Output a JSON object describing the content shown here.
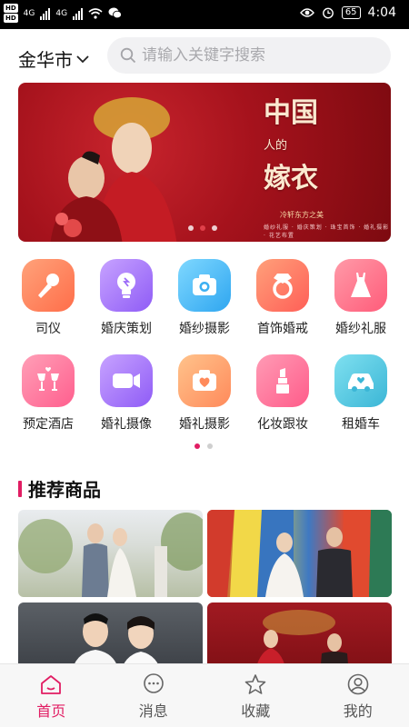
{
  "status_bar": {
    "hd1": "HD",
    "hd2": "HD",
    "net1": "4G",
    "net2": "4G",
    "battery": "65",
    "time": "4:04"
  },
  "header": {
    "city": "金华市",
    "search_placeholder": "请输入关键字搜索"
  },
  "banner": {
    "title_line1": "中国",
    "title_mid": "人的",
    "title_line2": "嫁衣",
    "tagline": "冷轩东方之美",
    "fineprint": "婚纱礼服 · 婚庆策划 · 珠宝首饰 · 婚礼摄影 · 花艺布置",
    "slide_count": 3,
    "active_slide": 2
  },
  "categories": [
    {
      "label": "司仪",
      "icon": "microphone-icon",
      "color1": "#ffa27a",
      "color2": "#ff6e4a"
    },
    {
      "label": "婚庆策划",
      "icon": "lightbulb-icon",
      "color1": "#c7a2ff",
      "color2": "#8f5cf6"
    },
    {
      "label": "婚纱摄影",
      "icon": "camera-icon",
      "color1": "#7fd8ff",
      "color2": "#2fa6f0"
    },
    {
      "label": "首饰婚戒",
      "icon": "diamond-ring-icon",
      "color1": "#ffa07a",
      "color2": "#ff5f57"
    },
    {
      "label": "婚纱礼服",
      "icon": "dress-icon",
      "color1": "#ff9aa8",
      "color2": "#ff5c7a"
    },
    {
      "label": "预定酒店",
      "icon": "wine-glasses-icon",
      "color1": "#ff9fb7",
      "color2": "#ff5f8e"
    },
    {
      "label": "婚礼摄像",
      "icon": "video-camera-icon",
      "color1": "#c7a2ff",
      "color2": "#8f5cf6"
    },
    {
      "label": "婚礼摄影",
      "icon": "heart-camera-icon",
      "color1": "#ffc38b",
      "color2": "#ff8a5b"
    },
    {
      "label": "化妆跟妆",
      "icon": "lipstick-icon",
      "color1": "#ff9bb5",
      "color2": "#ff5c8a"
    },
    {
      "label": "租婚车",
      "icon": "car-icon",
      "color1": "#7fe0f0",
      "color2": "#3bb6d6"
    }
  ],
  "category_pages": 2,
  "category_active_page": 1,
  "section": {
    "title": "推荐商品"
  },
  "tabs": [
    {
      "label": "首页",
      "icon": "home-icon",
      "active": true
    },
    {
      "label": "消息",
      "icon": "chat-bubble-icon",
      "active": false
    },
    {
      "label": "收藏",
      "icon": "star-icon",
      "active": false
    },
    {
      "label": "我的",
      "icon": "user-icon",
      "active": false
    }
  ],
  "colors": {
    "accent": "#e11d63",
    "banner_red": "#a5121c",
    "search_bg": "#f1f1f3"
  }
}
